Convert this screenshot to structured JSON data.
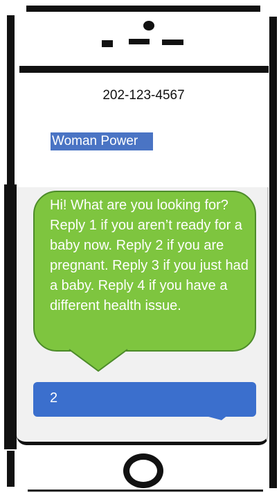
{
  "header": {
    "phone_number": "202-123-4567",
    "contact_name": "Woman Power"
  },
  "messages": [
    {
      "sender": "incoming",
      "text": "Hi! What are you looking for? Reply 1 if you aren’t ready for a baby now. Reply 2 if you are pregnant. Reply 3 if you just had a baby. Reply 4 if you have a different health issue."
    },
    {
      "sender": "outgoing",
      "text": "2"
    }
  ],
  "colors": {
    "incoming_bubble": "#7ec53f",
    "outgoing_bubble": "#3b6fcd",
    "contact_highlight": "#4a74c4"
  }
}
